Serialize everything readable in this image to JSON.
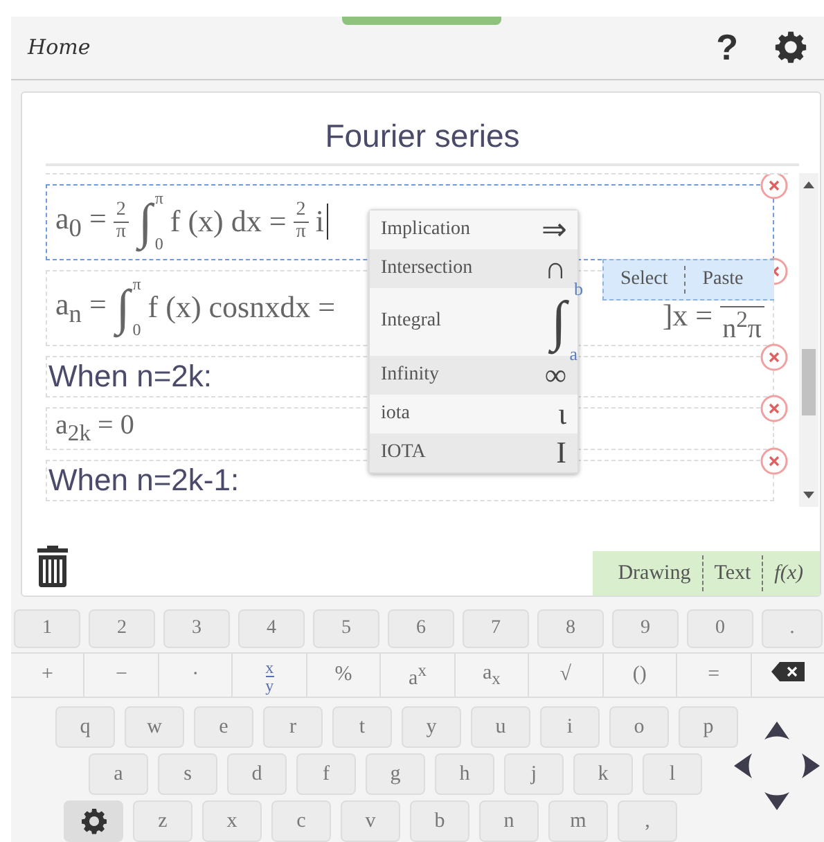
{
  "header": {
    "home": "Home",
    "help": "?"
  },
  "document": {
    "title": "Fourier series",
    "rows": [
      {
        "kind": "math",
        "selected": true,
        "cursor": true,
        "left": [
          {
            "kind": "text",
            "text": "a$_{0}$ ="
          },
          {
            "kind": "frac",
            "num": "2",
            "den": "π"
          },
          {
            "kind": "int",
            "sign": "∫",
            "lower": "0",
            "upper": "π"
          },
          {
            "kind": "text",
            "text": "f (x) dx ="
          },
          {
            "kind": "frac",
            "num": "2",
            "den": "π"
          },
          {
            "kind": "text",
            "text": "i"
          }
        ]
      },
      {
        "kind": "math",
        "selected": false,
        "cursor": false,
        "left": [
          {
            "kind": "text",
            "text": "a$_{n}$ ="
          },
          {
            "kind": "int",
            "sign": "∫",
            "lower": "0",
            "upper": "π"
          },
          {
            "kind": "text",
            "text": "f (x) cosnxdx ="
          }
        ],
        "right": [
          {
            "kind": "text",
            "text": "]x ="
          },
          {
            "kind": "frac",
            "den": "n$^{2}$π"
          }
        ]
      },
      {
        "kind": "text",
        "selected": false,
        "text": "When n=2k:"
      },
      {
        "kind": "math",
        "selected": false,
        "cursor": false,
        "left": [
          {
            "kind": "text",
            "text": "a$_{2k}$ = 0"
          }
        ]
      },
      {
        "kind": "text",
        "selected": false,
        "text": "When n=2k-1:"
      }
    ]
  },
  "symbol_menu": [
    {
      "label": "Implication",
      "symbol": "⇒"
    },
    {
      "label": "Intersection",
      "symbol": "∩"
    },
    {
      "label": "Integral",
      "symbol": "∫",
      "lower": "a",
      "upper": "b"
    },
    {
      "label": "Infinity",
      "symbol": "∞"
    },
    {
      "label": "iota",
      "symbol": "ι"
    },
    {
      "label": "IOTA",
      "symbol": "I"
    }
  ],
  "context_menu": [
    "Select",
    "Paste"
  ],
  "mode_tabs": [
    {
      "kind": "plain",
      "label": "Drawing"
    },
    {
      "kind": "plain",
      "label": "Text"
    },
    {
      "kind": "function",
      "label": "f(x)"
    }
  ],
  "keyboard": {
    "numbers": [
      "1",
      "2",
      "3",
      "4",
      "5",
      "6",
      "7",
      "8",
      "9",
      "0",
      "."
    ],
    "operators": [
      {
        "kind": "text",
        "label": "+"
      },
      {
        "kind": "text",
        "label": "−"
      },
      {
        "kind": "text",
        "label": "·"
      },
      {
        "kind": "frac",
        "num": "x",
        "den": "y"
      },
      {
        "kind": "text",
        "label": "%"
      },
      {
        "kind": "text",
        "label": "a$^{x}$"
      },
      {
        "kind": "text",
        "label": "a$_{x}$"
      },
      {
        "kind": "text",
        "label": "√"
      },
      {
        "kind": "text",
        "label": "()"
      },
      {
        "kind": "text",
        "label": "="
      },
      {
        "kind": "backspace"
      }
    ],
    "letters": [
      [
        "q",
        "w",
        "e",
        "r",
        "t",
        "y",
        "u",
        "i",
        "o",
        "p"
      ],
      [
        "a",
        "s",
        "d",
        "f",
        "g",
        "h",
        "j",
        "k",
        "l"
      ],
      [
        "z",
        "x",
        "c",
        "v",
        "b",
        "n",
        "m",
        ","
      ]
    ]
  }
}
